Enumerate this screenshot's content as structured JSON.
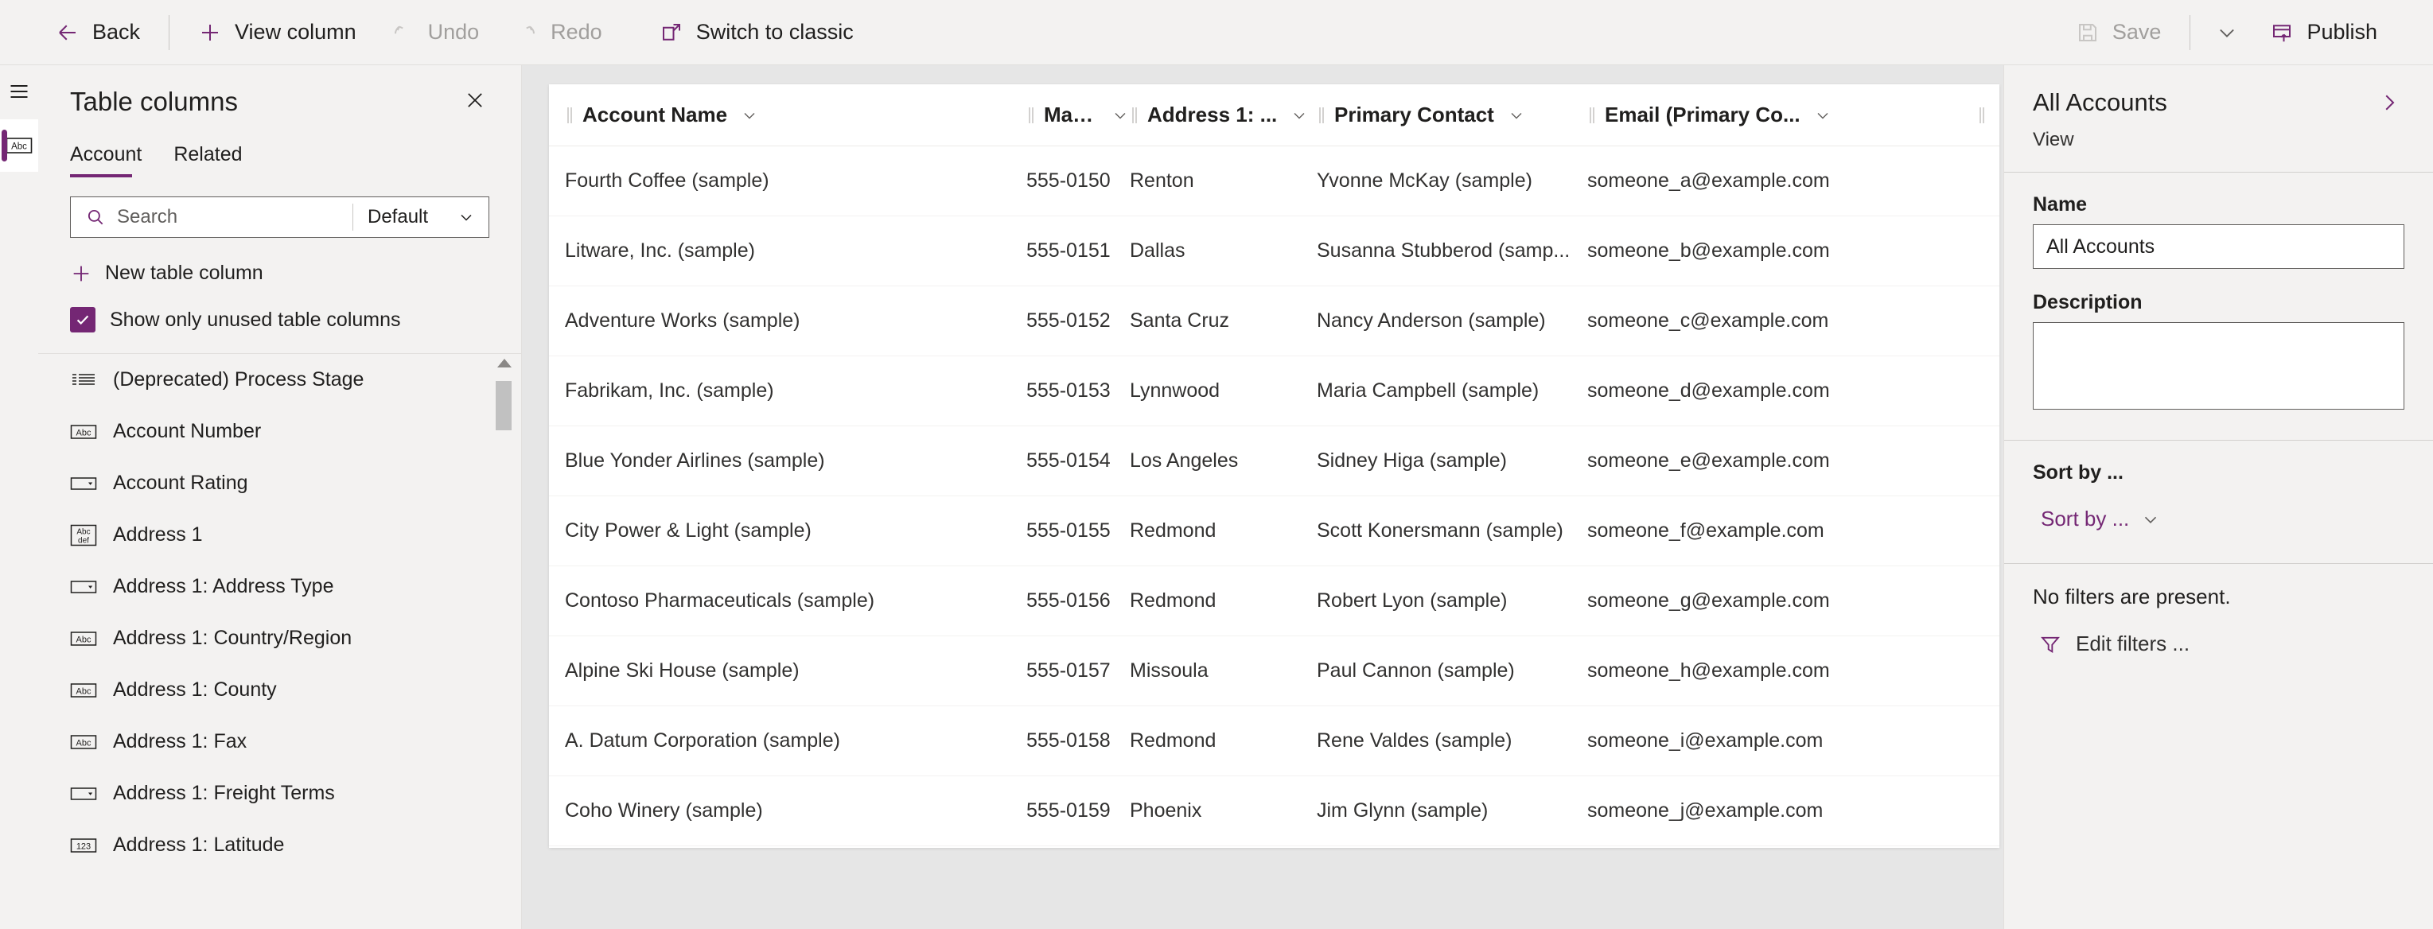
{
  "commandbar": {
    "back": "Back",
    "view_column": "View column",
    "undo": "Undo",
    "redo": "Redo",
    "switch_classic": "Switch to classic",
    "save": "Save",
    "publish": "Publish"
  },
  "table_columns_panel": {
    "title": "Table columns",
    "tabs": [
      {
        "label": "Account",
        "active": true
      },
      {
        "label": "Related",
        "active": false
      }
    ],
    "search_placeholder": "Search",
    "filter_selected": "Default",
    "new_column": "New table column",
    "show_unused_label": "Show only unused table columns",
    "show_unused_checked": true,
    "items": [
      {
        "label": "(Deprecated) Process Stage",
        "icon": "list-icon"
      },
      {
        "label": "Account Number",
        "icon": "abc-icon"
      },
      {
        "label": "Account Rating",
        "icon": "dropdown-icon"
      },
      {
        "label": "Address 1",
        "icon": "abcdef-icon"
      },
      {
        "label": "Address 1: Address Type",
        "icon": "dropdown-icon"
      },
      {
        "label": "Address 1: Country/Region",
        "icon": "abc-icon"
      },
      {
        "label": "Address 1: County",
        "icon": "abc-icon"
      },
      {
        "label": "Address 1: Fax",
        "icon": "abc-icon"
      },
      {
        "label": "Address 1: Freight Terms",
        "icon": "dropdown-icon"
      },
      {
        "label": "Address 1: Latitude",
        "icon": "123-icon"
      }
    ]
  },
  "grid": {
    "columns": [
      "Account Name",
      "Main Phone",
      "Address 1: ...",
      "Primary Contact",
      "Email (Primary Co..."
    ],
    "rows": [
      [
        "Fourth Coffee (sample)",
        "555-0150",
        "Renton",
        "Yvonne McKay (sample)",
        "someone_a@example.com"
      ],
      [
        "Litware, Inc. (sample)",
        "555-0151",
        "Dallas",
        "Susanna Stubberod (samp...",
        "someone_b@example.com"
      ],
      [
        "Adventure Works (sample)",
        "555-0152",
        "Santa Cruz",
        "Nancy Anderson (sample)",
        "someone_c@example.com"
      ],
      [
        "Fabrikam, Inc. (sample)",
        "555-0153",
        "Lynnwood",
        "Maria Campbell (sample)",
        "someone_d@example.com"
      ],
      [
        "Blue Yonder Airlines (sample)",
        "555-0154",
        "Los Angeles",
        "Sidney Higa (sample)",
        "someone_e@example.com"
      ],
      [
        "City Power & Light (sample)",
        "555-0155",
        "Redmond",
        "Scott Konersmann (sample)",
        "someone_f@example.com"
      ],
      [
        "Contoso Pharmaceuticals (sample)",
        "555-0156",
        "Redmond",
        "Robert Lyon (sample)",
        "someone_g@example.com"
      ],
      [
        "Alpine Ski House (sample)",
        "555-0157",
        "Missoula",
        "Paul Cannon (sample)",
        "someone_h@example.com"
      ],
      [
        "A. Datum Corporation (sample)",
        "555-0158",
        "Redmond",
        "Rene Valdes (sample)",
        "someone_i@example.com"
      ],
      [
        "Coho Winery (sample)",
        "555-0159",
        "Phoenix",
        "Jim Glynn (sample)",
        "someone_j@example.com"
      ]
    ]
  },
  "properties_panel": {
    "title": "All Accounts",
    "subtitle": "View",
    "name_label": "Name",
    "name_value": "All Accounts",
    "description_label": "Description",
    "description_value": "",
    "sort_section_label": "Sort by ...",
    "sort_by_value": "Sort by ...",
    "no_filters": "No filters are present.",
    "edit_filters": "Edit filters ..."
  },
  "colors": {
    "accent": "#742774",
    "panel_bg": "#f3f2f1",
    "page_bg": "#e6e6e6",
    "text": "#201f1e",
    "muted": "#a19f9d"
  }
}
